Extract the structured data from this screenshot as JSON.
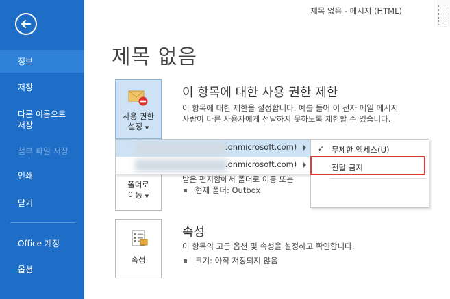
{
  "window": {
    "title": "제목 없음 - 메시지 (HTML)"
  },
  "nav": {
    "items": [
      {
        "label": "정보",
        "state": "active"
      },
      {
        "label": "저장",
        "state": "normal"
      },
      {
        "label": "다른 이름으로\n저장",
        "state": "normal"
      },
      {
        "label": "첨부 파일 저장",
        "state": "disabled"
      },
      {
        "label": "인쇄",
        "state": "normal"
      },
      {
        "label": "닫기",
        "state": "normal"
      },
      {
        "label": "Office 계정",
        "state": "normal"
      },
      {
        "label": "옵션",
        "state": "normal"
      }
    ]
  },
  "page": {
    "title": "제목 없음"
  },
  "permission": {
    "button_line1": "사용 권한",
    "button_line2": "설정",
    "heading": "이 항목에 대한 사용 권한 제한",
    "desc_line1": "이 항목에 대한 제한을 설정합니다. 예를 들어 이 전자 메일 메시지",
    "desc_line2": "사람이 다른 사용자에게 전달하지 못하도록 제한할 수 있습니다."
  },
  "move": {
    "button_line1": "폴더로",
    "button_line2": "이동",
    "desc": "받은 편지함에서 폴더로 이동 또는",
    "current_folder": "현재 폴더:   Outbox"
  },
  "properties": {
    "button_label": "속성",
    "heading": "속성",
    "desc": "이 항목의 고급 옵션 및 속성을 설정하고 확인합니다.",
    "size": "크기:    아직 저장되지 않음"
  },
  "menu": {
    "accounts": [
      {
        "suffix": ".onmicrosoft.com)"
      },
      {
        "suffix": ".onmicrosoft.com)"
      }
    ]
  },
  "submenu": {
    "items": [
      {
        "label": "무제한 액세스(U)",
        "checked": true
      },
      {
        "label": "전달 금지",
        "checked": false
      }
    ]
  },
  "colors": {
    "nav_bg": "#1e6ec7",
    "nav_active": "#2f82d8",
    "highlight": "#e03a3a",
    "hover": "#cde3f5"
  }
}
